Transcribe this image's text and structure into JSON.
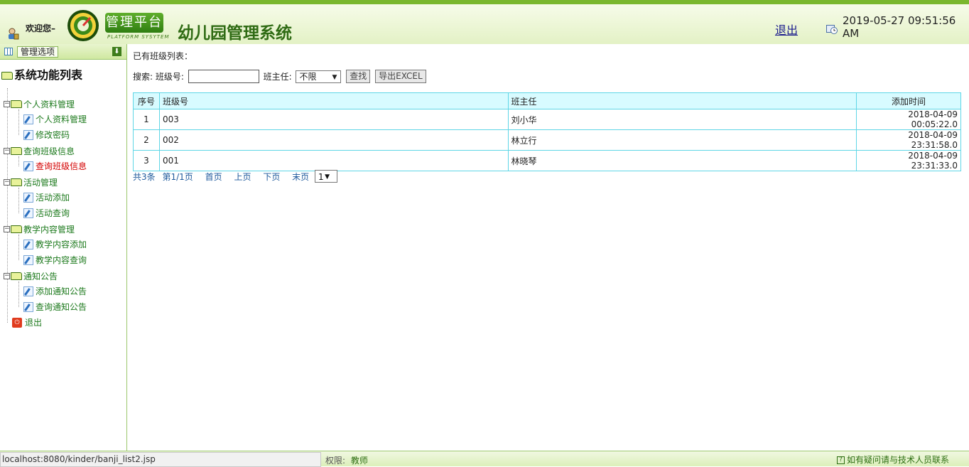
{
  "header": {
    "welcome": "欢迎您–",
    "badge": "管理平台",
    "badge_sub": "PLATFORM SYSYTEM",
    "system_title": "幼儿园管理系统",
    "logout": "退出",
    "datetime": "2019-05-27 09:51:56 AM"
  },
  "sidebar": {
    "header_title": "管理选项",
    "root": "系统功能列表",
    "groups": [
      {
        "label": "个人资料管理",
        "items": [
          "个人资料管理",
          "修改密码"
        ]
      },
      {
        "label": "查询班级信息",
        "items": [
          "查询班级信息"
        ]
      },
      {
        "label": "活动管理",
        "items": [
          "活动添加",
          "活动查询"
        ]
      },
      {
        "label": "教学内容管理",
        "items": [
          "教学内容添加",
          "教学内容查询"
        ]
      },
      {
        "label": "通知公告",
        "items": [
          "添加通知公告",
          "查询通知公告"
        ]
      }
    ],
    "exit": "退出"
  },
  "main": {
    "list_title": "已有班级列表：",
    "search_label": "搜索: 班级号:",
    "search_value": "",
    "teacher_label": "班主任:",
    "teacher_select": "不限",
    "search_button": "查找",
    "export_button": "导出EXCEL",
    "table": {
      "headers": [
        "序号",
        "班级号",
        "班主任",
        "添加时间"
      ],
      "rows": [
        [
          "1",
          "003",
          "刘小华",
          "2018-04-09 00:05:22.0"
        ],
        [
          "2",
          "002",
          "林立行",
          "2018-04-09 23:31:58.0"
        ],
        [
          "3",
          "001",
          "林晓琴",
          "2018-04-09 23:31:33.0"
        ]
      ]
    },
    "pager": {
      "total": "共3条",
      "page": "第1/1页",
      "first": "首页",
      "prev": "上页",
      "next": "下页",
      "last": "末页",
      "select": "1"
    }
  },
  "footer": {
    "status_url": "localhost:8080/kinder/banji_list2.jsp",
    "perm_label": "权限:",
    "perm_value": "教师",
    "help": "如有疑问请与技术人员联系"
  },
  "colors": {
    "brand_green": "#2f7e12",
    "table_border": "#5fd6e6",
    "active_item": "#d40000"
  }
}
